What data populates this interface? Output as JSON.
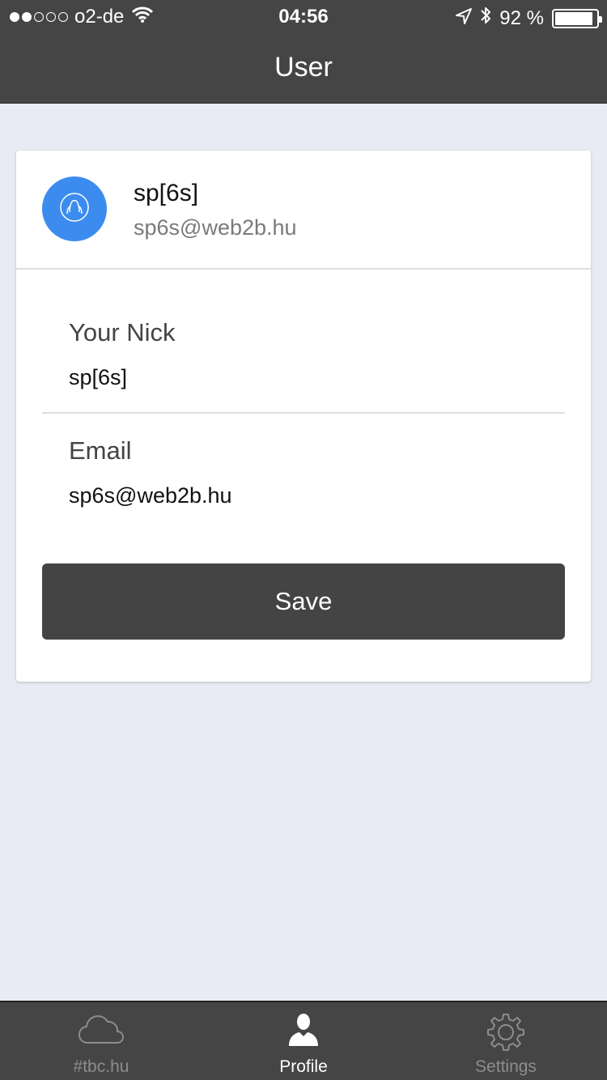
{
  "status_bar": {
    "carrier": "o2-de",
    "time": "04:56",
    "battery_text": "92 %",
    "battery_level": 0.92,
    "signal_bars_filled": 2,
    "signal_bars_total": 5
  },
  "nav": {
    "title": "User"
  },
  "profile": {
    "name": "sp[6s]",
    "email": "sp6s@web2b.hu",
    "avatar_color": "#3c8cf0"
  },
  "form": {
    "nick_label": "Your Nick",
    "nick_value": "sp[6s]",
    "email_label": "Email",
    "email_value": "sp6s@web2b.hu",
    "save_label": "Save"
  },
  "tabs": [
    {
      "label": "#tbc.hu",
      "icon": "cloud-icon",
      "active": false
    },
    {
      "label": "Profile",
      "icon": "person-icon",
      "active": true
    },
    {
      "label": "Settings",
      "icon": "gear-icon",
      "active": false
    }
  ],
  "colors": {
    "bar_background": "#454545",
    "page_background": "#e8ebf3",
    "button_background": "#444444",
    "tab_inactive": "#8d8d8d",
    "tab_active": "#ffffff"
  }
}
